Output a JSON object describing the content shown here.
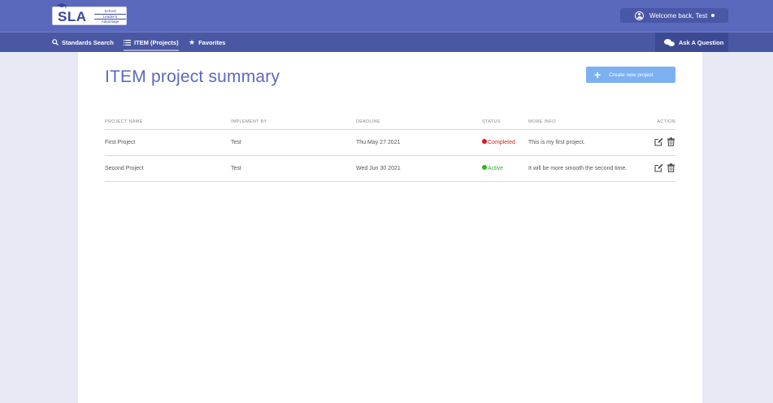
{
  "header": {
    "logo_text": "SLA",
    "logo_subtitle": [
      "School",
      "Leader's",
      "Advantage"
    ],
    "welcome_text": "Welcome back, Test"
  },
  "nav": {
    "items": [
      {
        "label": "Standards Search",
        "icon": "search-icon"
      },
      {
        "label": "ITEM (Projects)",
        "icon": "list-icon",
        "active": true
      },
      {
        "label": "Favorites",
        "icon": "star-icon"
      }
    ],
    "ask_label": "Ask A Question"
  },
  "main": {
    "title": "ITEM project summary",
    "create_label": "Create new project",
    "columns": [
      "PROJECT NAME",
      "IMPLEMENT BY",
      "DEADLINE",
      "STATUS",
      "MORE INFO",
      "ACTION"
    ],
    "rows": [
      {
        "name": "First Project",
        "implement_by": "Test",
        "deadline": "Thu May 27 2021",
        "status": "Completed",
        "status_color": "#e01818",
        "info": "This is my first project."
      },
      {
        "name": "Second Project",
        "implement_by": "Test",
        "deadline": "Wed Jun 30 2021",
        "status": "Active",
        "status_color": "#28b828",
        "info": "It will be more smooth the second time."
      }
    ]
  },
  "colors": {
    "header_bg": "#5b69bd",
    "nav_bg": "#4a58a4",
    "accent": "#5b69bd",
    "button": "#7db0f0",
    "page_bg": "#e8e9f5"
  }
}
